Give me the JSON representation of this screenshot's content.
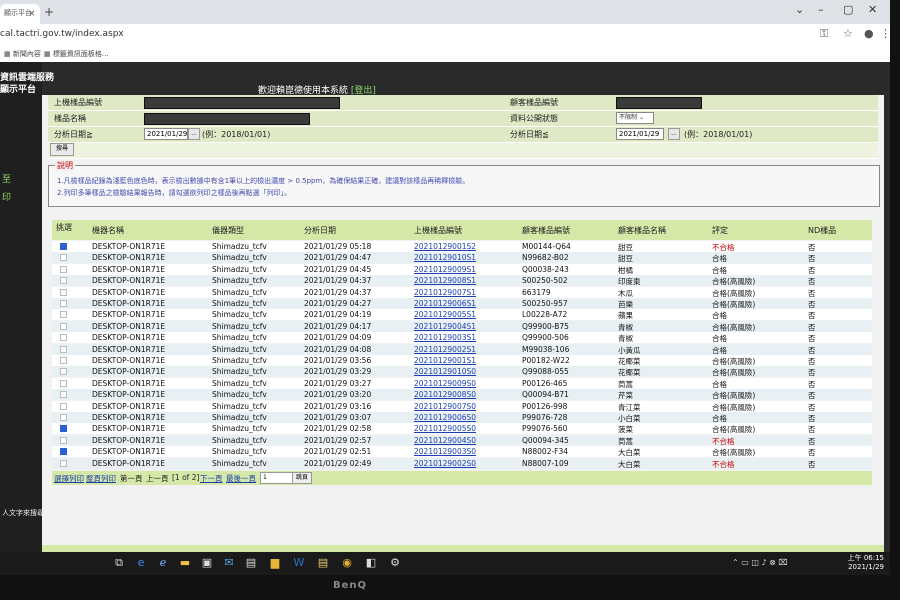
{
  "browser": {
    "tab_title": "顯示平台",
    "url": "cal.tactri.gov.tw/index.aspx",
    "bookmarks": [
      "新聞內容",
      "標籤資訊面板格..."
    ]
  },
  "site": {
    "brand_line1": "資訊雲端服務",
    "brand_line2": "顯示平台",
    "welcome": "歡迎賴崑德使用本系統",
    "logout": "[登出]",
    "side_links": [
      "至",
      "印"
    ]
  },
  "filter": {
    "upload_id_label": "上機樣品編號",
    "client_id_label": "顧客樣品編號",
    "sample_name_label": "樣品名稱",
    "public_status_label": "資料公開狀態",
    "public_status_value": "不限制",
    "date_from_label": "分析日期≧",
    "date_from_value": "2021/01/29",
    "date_from_hint": "(例：2018/01/01)",
    "date_to_label": "分析日期≦",
    "date_to_value": "2021/01/29",
    "date_to_hint": "(例：2018/01/01)",
    "picker_btn": "...",
    "query_btn": "搜尋"
  },
  "notice": {
    "title": "說明",
    "line1": "1.凡檢樣品紀錄為淺藍色底色時，表示檢出數據中有含1筆以上的檢出濃度 > 0.5ppm，為確保結果正確，建議對該樣品再稀釋檢驗。",
    "line2": "2.列印多筆樣品之檢驗結果報告時，請勾選欲列印之樣品後再點選「列印」。"
  },
  "table": {
    "headers": [
      "挑選",
      "機器名稱",
      "儀器類型",
      "分析日期",
      "上機樣品編號",
      "顧客樣品編號",
      "顧客樣品名稱",
      "評定",
      "ND樣品"
    ],
    "rows": [
      {
        "checked": true,
        "machine": "DESKTOP-ON1R71E",
        "instrument": "Shimadzu_tcfv",
        "date": "2021/01/29 05:18",
        "upload_id": "20210129001S2",
        "client_id": "M00144-Q64",
        "name": "甜豆",
        "result": "不合格",
        "fail": true,
        "nd": "否"
      },
      {
        "checked": false,
        "machine": "DESKTOP-ON1R71E",
        "instrument": "Shimadzu_tcfv",
        "date": "2021/01/29 04:47",
        "upload_id": "20210129010S1",
        "client_id": "N99682-B02",
        "name": "甜豆",
        "result": "合格",
        "fail": false,
        "nd": "否"
      },
      {
        "checked": false,
        "machine": "DESKTOP-ON1R71E",
        "instrument": "Shimadzu_tcfv",
        "date": "2021/01/29 04:45",
        "upload_id": "20210129009S1",
        "client_id": "Q00038-243",
        "name": "柑橘",
        "result": "合格",
        "fail": false,
        "nd": "否"
      },
      {
        "checked": false,
        "machine": "DESKTOP-ON1R71E",
        "instrument": "Shimadzu_tcfv",
        "date": "2021/01/29 04:37",
        "upload_id": "20210129008S1",
        "client_id": "S00250-502",
        "name": "印度棗",
        "result": "合格(高風險)",
        "fail": false,
        "nd": "否"
      },
      {
        "checked": false,
        "machine": "DESKTOP-ON1R71E",
        "instrument": "Shimadzu_tcfv",
        "date": "2021/01/29 04:37",
        "upload_id": "20210129007S1",
        "client_id": "663179",
        "name": "木瓜",
        "result": "合格(高風險)",
        "fail": false,
        "nd": "否"
      },
      {
        "checked": false,
        "machine": "DESKTOP-ON1R71E",
        "instrument": "Shimadzu_tcfv",
        "date": "2021/01/29 04:27",
        "upload_id": "20210129006S1",
        "client_id": "S00250-957",
        "name": "芭樂",
        "result": "合格(高風險)",
        "fail": false,
        "nd": "否"
      },
      {
        "checked": false,
        "machine": "DESKTOP-ON1R71E",
        "instrument": "Shimadzu_tcfv",
        "date": "2021/01/29 04:19",
        "upload_id": "20210129005S1",
        "client_id": "L00228-A72",
        "name": "蘋果",
        "result": "合格",
        "fail": false,
        "nd": "否"
      },
      {
        "checked": false,
        "machine": "DESKTOP-ON1R71E",
        "instrument": "Shimadzu_tcfv",
        "date": "2021/01/29 04:17",
        "upload_id": "20210129004S1",
        "client_id": "Q99900-B75",
        "name": "青椒",
        "result": "合格(高風險)",
        "fail": false,
        "nd": "否"
      },
      {
        "checked": false,
        "machine": "DESKTOP-ON1R71E",
        "instrument": "Shimadzu_tcfv",
        "date": "2021/01/29 04:09",
        "upload_id": "20210129003S1",
        "client_id": "Q99900-506",
        "name": "青椒",
        "result": "合格",
        "fail": false,
        "nd": "否"
      },
      {
        "checked": false,
        "machine": "DESKTOP-ON1R71E",
        "instrument": "Shimadzu_tcfv",
        "date": "2021/01/29 04:08",
        "upload_id": "20210129002S1",
        "client_id": "M99038-106",
        "name": "小黃瓜",
        "result": "合格",
        "fail": false,
        "nd": "否"
      },
      {
        "checked": false,
        "machine": "DESKTOP-ON1R71E",
        "instrument": "Shimadzu_tcfv",
        "date": "2021/01/29 03:56",
        "upload_id": "20210129001S1",
        "client_id": "P00182-W22",
        "name": "花椰菜",
        "result": "合格(高風險)",
        "fail": false,
        "nd": "否"
      },
      {
        "checked": false,
        "machine": "DESKTOP-ON1R71E",
        "instrument": "Shimadzu_tcfv",
        "date": "2021/01/29 03:29",
        "upload_id": "20210129010S0",
        "client_id": "Q99088-055",
        "name": "花椰菜",
        "result": "合格(高風險)",
        "fail": false,
        "nd": "否"
      },
      {
        "checked": false,
        "machine": "DESKTOP-ON1R71E",
        "instrument": "Shimadzu_tcfv",
        "date": "2021/01/29 03:27",
        "upload_id": "20210129009S0",
        "client_id": "P00126-465",
        "name": "茼蒿",
        "result": "合格",
        "fail": false,
        "nd": "否"
      },
      {
        "checked": false,
        "machine": "DESKTOP-ON1R71E",
        "instrument": "Shimadzu_tcfv",
        "date": "2021/01/29 03:20",
        "upload_id": "20210129008S0",
        "client_id": "Q00094-B71",
        "name": "芹菜",
        "result": "合格(高風險)",
        "fail": false,
        "nd": "否"
      },
      {
        "checked": false,
        "machine": "DESKTOP-ON1R71E",
        "instrument": "Shimadzu_tcfv",
        "date": "2021/01/29 03:16",
        "upload_id": "20210129007S0",
        "client_id": "P00126-998",
        "name": "青江菜",
        "result": "合格(高風險)",
        "fail": false,
        "nd": "否"
      },
      {
        "checked": false,
        "machine": "DESKTOP-ON1R71E",
        "instrument": "Shimadzu_tcfv",
        "date": "2021/01/29 03:07",
        "upload_id": "20210129006S0",
        "client_id": "P99076-728",
        "name": "小白菜",
        "result": "合格",
        "fail": false,
        "nd": "否"
      },
      {
        "checked": true,
        "machine": "DESKTOP-ON1R71E",
        "instrument": "Shimadzu_tcfv",
        "date": "2021/01/29 02:58",
        "upload_id": "20210129005S0",
        "client_id": "P99076-560",
        "name": "菠菜",
        "result": "合格(高風險)",
        "fail": false,
        "nd": "否"
      },
      {
        "checked": false,
        "machine": "DESKTOP-ON1R71E",
        "instrument": "Shimadzu_tcfv",
        "date": "2021/01/29 02:57",
        "upload_id": "20210129004S0",
        "client_id": "Q00094-345",
        "name": "茼蒿",
        "result": "不合格",
        "fail": true,
        "nd": "否"
      },
      {
        "checked": true,
        "machine": "DESKTOP-ON1R71E",
        "instrument": "Shimadzu_tcfv",
        "date": "2021/01/29 02:51",
        "upload_id": "20210129003S0",
        "client_id": "N88002-F34",
        "name": "大白菜",
        "result": "合格(高風險)",
        "fail": false,
        "nd": "否"
      },
      {
        "checked": false,
        "machine": "DESKTOP-ON1R71E",
        "instrument": "Shimadzu_tcfv",
        "date": "2021/01/29 02:49",
        "upload_id": "20210129002S0",
        "client_id": "N88007-109",
        "name": "大白菜",
        "result": "不合格",
        "fail": true,
        "nd": "否"
      }
    ]
  },
  "pager": {
    "print_selected": "選擇列印",
    "print_all": "整頁列印",
    "first": "第一頁",
    "prev": "上一頁",
    "info": "[1 of 2]",
    "next": "下一頁",
    "last": "最後一頁",
    "page_input": "1",
    "go": "跳頁"
  },
  "taskbar": {
    "search_hint": "人文字來搜尋",
    "time": "上午 06:15",
    "date": "2021/1/29"
  },
  "monitor_brand": "BenQ"
}
